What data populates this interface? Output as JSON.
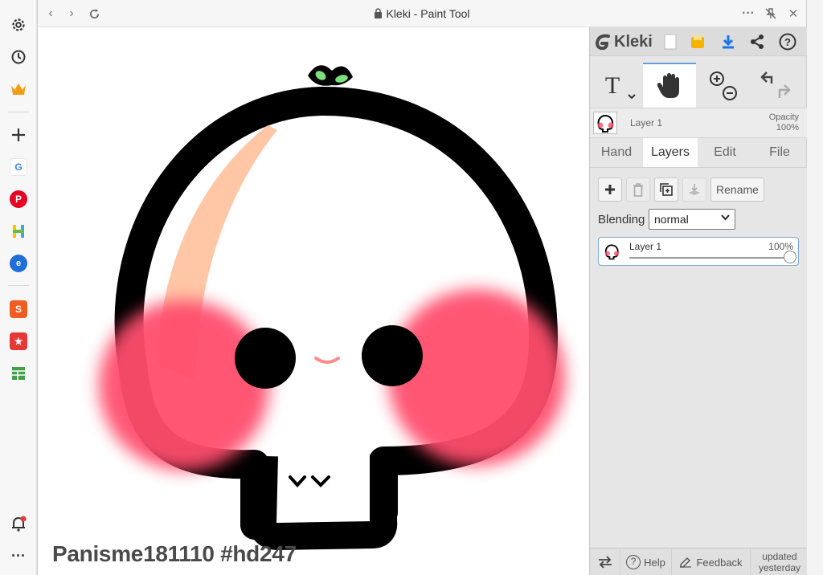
{
  "window": {
    "title": "Kleki - Paint Tool",
    "menu_more": "···"
  },
  "canvas": {
    "caption": "Panisme181110 #hd247"
  },
  "panel": {
    "logo": "Kleki",
    "layer_name": "Layer 1",
    "opacity_label": "Opacity",
    "opacity_value": "100%",
    "tabs": [
      "Hand",
      "Layers",
      "Edit",
      "File"
    ],
    "active_tab": "Layers",
    "rename_label": "Rename",
    "blending_label": "Blending",
    "blending_value": "normal",
    "layers": [
      {
        "name": "Layer 1",
        "opacity": "100%",
        "opacity_fraction": 1.0
      }
    ],
    "footer": {
      "help": "Help",
      "feedback": "Feedback",
      "updated_line1": "updated",
      "updated_line2": "yesterday"
    }
  },
  "colors": {
    "accent": "#1a73e8",
    "blush": "#ff4d6d",
    "peach": "#ffc7a6",
    "sprout": "#7be07b",
    "shopee": "#f05d22"
  }
}
